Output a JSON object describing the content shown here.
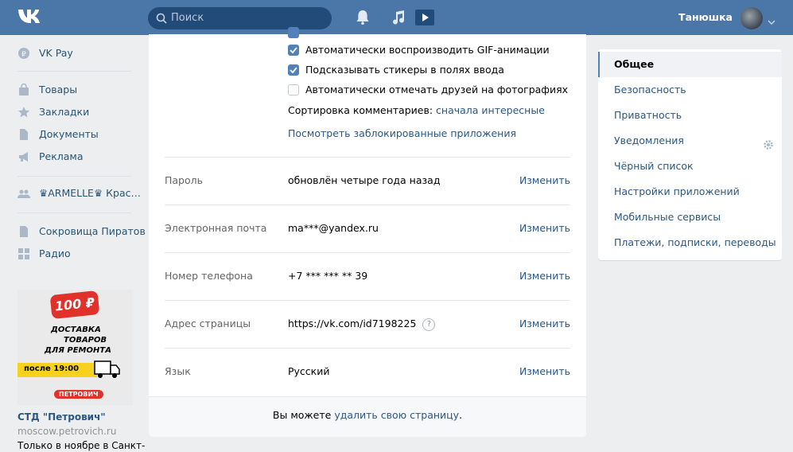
{
  "header": {
    "search_placeholder": "Поиск",
    "user_name": "Танюшка"
  },
  "left_nav": {
    "items": [
      {
        "label": "VK Pay",
        "icon": "vk-pay-icon"
      },
      {
        "label": "Товары",
        "icon": "bag-icon"
      },
      {
        "label": "Закладки",
        "icon": "star-icon"
      },
      {
        "label": "Документы",
        "icon": "document-icon"
      },
      {
        "label": "Реклама",
        "icon": "megaphone-icon"
      },
      {
        "label": "♛ARMELLE♛ Крас…",
        "icon": "group-icon"
      },
      {
        "label": "Сокровища Пиратов",
        "icon": "game-icon"
      },
      {
        "label": "Радио",
        "icon": "apps-icon"
      }
    ]
  },
  "ad": {
    "badge": "100 ₽",
    "line1": "ДОСТАВКА",
    "line2": "ТОВАРОВ",
    "line3": "ДЛЯ РЕМОНТА",
    "time": "после 19:00",
    "brand": "ПЕТРОВИЧ",
    "title": "СТД \"Петрович\"",
    "domain": "moscow.petrovich.ru",
    "text": "Только в ноябре в Санкт-"
  },
  "settings": {
    "checkboxes": [
      {
        "label": "Автоматически воспроизводить GIF-анимации",
        "checked": true
      },
      {
        "label": "Подсказывать стикеры в полях ввода",
        "checked": true
      },
      {
        "label": "Автоматически отмечать друзей на фотографиях",
        "checked": false
      }
    ],
    "sort_label": "Сортировка комментариев:",
    "sort_value": "сначала интересные",
    "blocked_apps_link": "Посмотреть заблокированные приложения",
    "rows": [
      {
        "label": "Пароль",
        "value": "обновлён четыре года назад",
        "action": "Изменить"
      },
      {
        "label": "Электронная почта",
        "value": "ma***@yandex.ru",
        "action": "Изменить"
      },
      {
        "label": "Номер телефона",
        "value": "+7 *** *** ** 39",
        "action": "Изменить"
      },
      {
        "label": "Адрес страницы",
        "value": "https://vk.com/id7198225",
        "action": "Изменить"
      },
      {
        "label": "Язык",
        "value": "Русский",
        "action": "Изменить"
      }
    ],
    "help_glyph": "?",
    "footer_text": "Вы можете ",
    "footer_link": "удалить свою страницу",
    "footer_end": "."
  },
  "right_menu": {
    "items": [
      {
        "label": "Общее",
        "active": true
      },
      {
        "label": "Безопасность"
      },
      {
        "label": "Приватность"
      },
      {
        "label": "Уведомления"
      },
      {
        "label": "Чёрный список"
      },
      {
        "label": "Настройки приложений"
      },
      {
        "label": "Мобильные сервисы"
      },
      {
        "label": "Платежи, подписки, переводы"
      }
    ]
  },
  "colors": {
    "header": "#4a76a8",
    "accent": "#5181b8",
    "link": "#2a5885"
  }
}
